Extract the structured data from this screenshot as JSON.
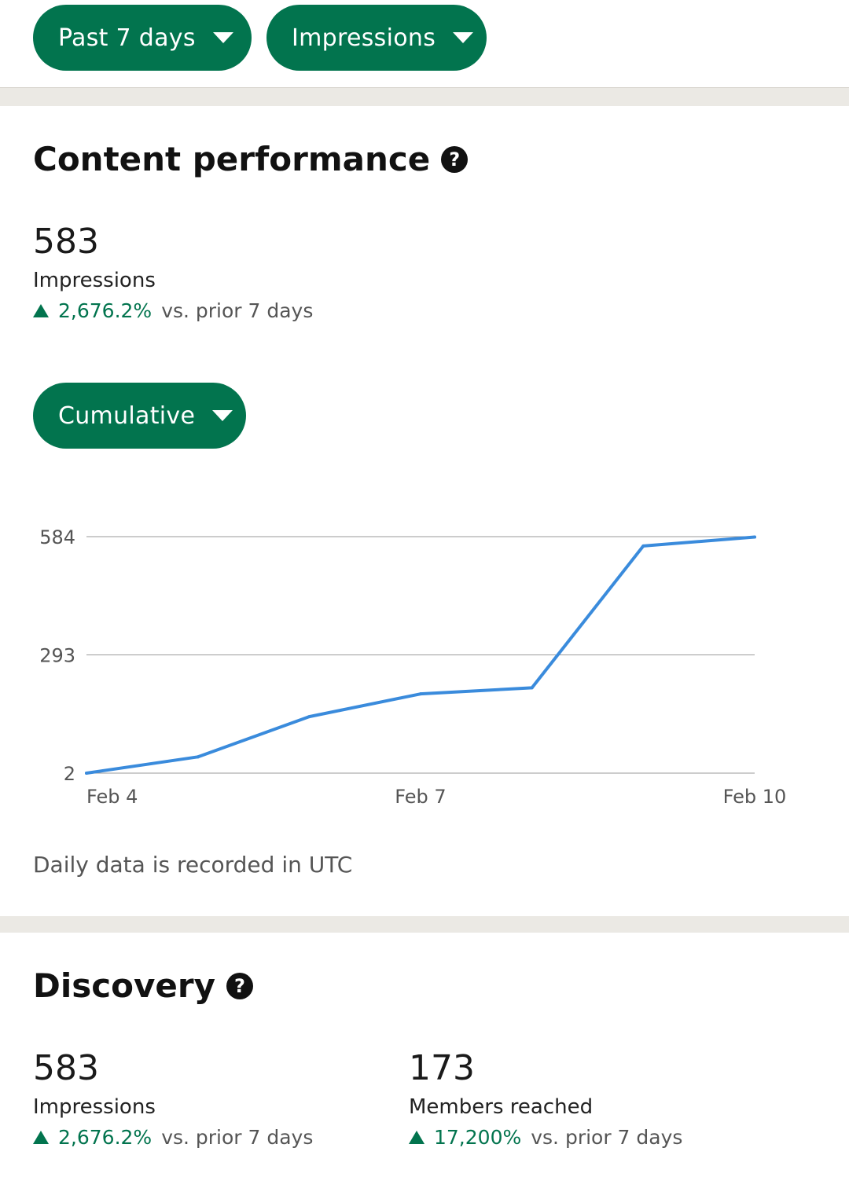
{
  "filters": {
    "range_label": "Past 7 days",
    "metric_label": "Impressions"
  },
  "content_performance": {
    "title": "Content performance",
    "help_icon": "?",
    "value": "583",
    "label": "Impressions",
    "change_pct": "2,676.2%",
    "change_text": "vs. prior 7 days",
    "mode_label": "Cumulative",
    "footnote": "Daily data is recorded in UTC"
  },
  "chart_data": {
    "type": "line",
    "x": [
      "Feb 4",
      "Feb 5",
      "Feb 6",
      "Feb 7",
      "Feb 8",
      "Feb 9",
      "Feb 10"
    ],
    "series": [
      {
        "values": [
          2,
          42,
          141,
          197,
          212,
          561,
          583
        ]
      }
    ],
    "y_ticks": [
      "584",
      "293",
      "2"
    ],
    "x_ticks": [
      "Feb 4",
      "Feb 7",
      "Feb 10"
    ],
    "ylim": [
      2,
      584
    ],
    "grid": true,
    "line_color": "#3a8bdc"
  },
  "discovery": {
    "title": "Discovery",
    "help_icon": "?",
    "metrics": [
      {
        "value": "583",
        "label": "Impressions",
        "change_pct": "2,676.2%",
        "change_text": "vs. prior 7 days"
      },
      {
        "value": "173",
        "label": "Members reached",
        "change_pct": "17,200%",
        "change_text": "vs. prior 7 days"
      }
    ]
  },
  "colors": {
    "accent": "#02744e",
    "positive": "#02744e",
    "band": "#ebe9e4"
  }
}
